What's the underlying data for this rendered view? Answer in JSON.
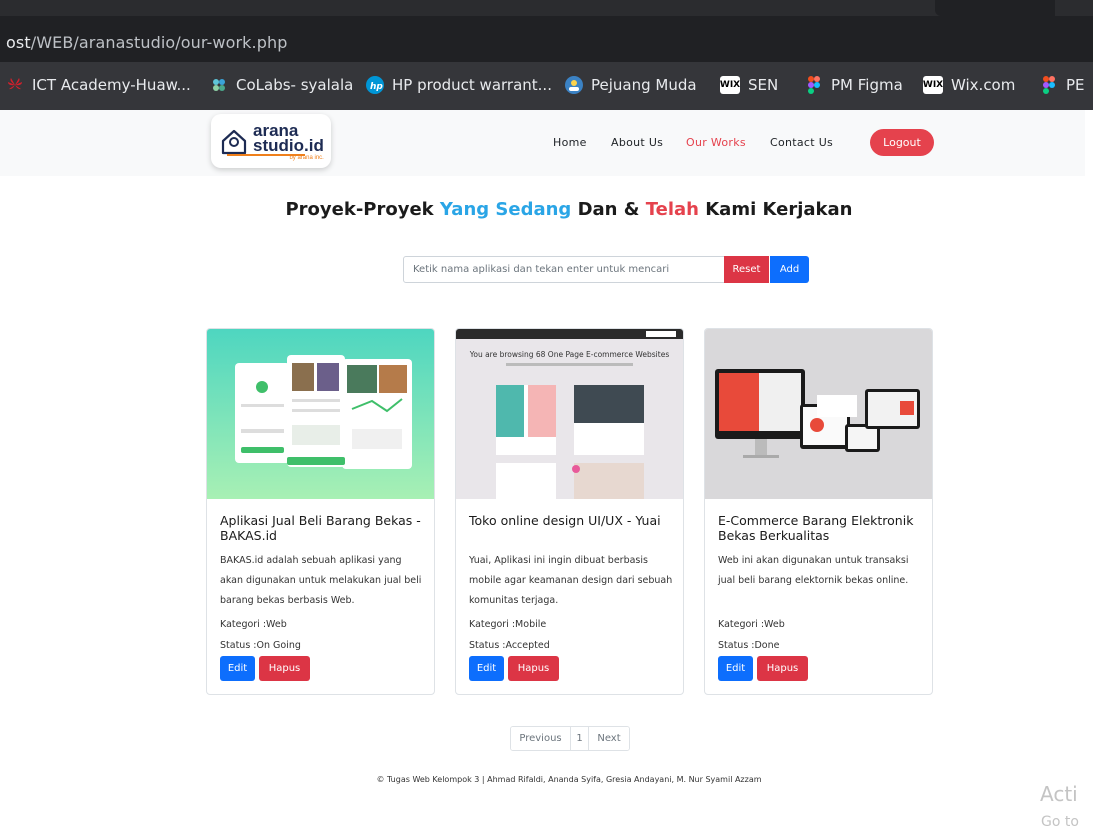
{
  "browser": {
    "url_host": "ost",
    "url_path": "/WEB/aranastudio/our-work.php",
    "bookmarks": [
      {
        "label": "ICT Academy-Huaw...",
        "icon": "huawei-icon",
        "color": "#d3202c"
      },
      {
        "label": "CoLabs- syalala",
        "icon": "colabs-icon",
        "color": "#3aa3d8"
      },
      {
        "label": "HP product warrant...",
        "icon": "hp-icon",
        "color": "#0096d6"
      },
      {
        "label": "Pejuang Muda",
        "icon": "pejuang-muda-icon",
        "color": "#3b82c4"
      },
      {
        "label": "SEN",
        "icon": "wix-icon",
        "color": "#ffffff"
      },
      {
        "label": "PM Figma",
        "icon": "figma-icon",
        "color": "#f24e1e"
      },
      {
        "label": "Wix.com",
        "icon": "wix-icon",
        "color": "#ffffff"
      },
      {
        "label": "PE",
        "icon": "figma-icon",
        "color": "#f24e1e"
      }
    ]
  },
  "logo": {
    "name": "arana",
    "name2": "studio.id",
    "tagline": "by arana inc."
  },
  "nav": {
    "home": "Home",
    "about": "About Us",
    "works": "Our Works",
    "contact": "Contact Us",
    "logout": "Logout"
  },
  "heading": {
    "part1": "Proyek-Proyek ",
    "part2": "Yang Sedang",
    "part3": " Dan & ",
    "part4": "Telah",
    "part5": " Kami Kerjakan"
  },
  "search": {
    "placeholder": "Ketik nama aplikasi dan tekan enter untuk mencari",
    "reset": "Reset",
    "add": "Add"
  },
  "cards": [
    {
      "title": "Aplikasi Jual Beli Barang Bekas - BAKAS.id",
      "desc": "BAKAS.id adalah sebuah aplikasi yang akan digunakan untuk melakukan jual beli barang bekas berbasis Web.",
      "kategori": "Kategori :Web",
      "status": "Status :On Going",
      "edit": "Edit",
      "hapus": "Hapus"
    },
    {
      "title": "Toko online design UI/UX - Yuai",
      "desc": "Yuai, Aplikasi ini ingin dibuat berbasis mobile agar keamanan design dari sebuah komunitas terjaga.",
      "kategori": "Kategori :Mobile",
      "status": "Status :Accepted",
      "edit": "Edit",
      "hapus": "Hapus",
      "image_text": "You are browsing 68 One Page E-commerce Websites"
    },
    {
      "title": "E-Commerce Barang Elektronik Bekas Berkualitas",
      "desc": "Web ini akan digunakan untuk transaksi jual beli barang elektornik bekas online.",
      "kategori": "Kategori :Web",
      "status": "Status :Done",
      "edit": "Edit",
      "hapus": "Hapus"
    }
  ],
  "pagination": {
    "previous": "Previous",
    "page": "1",
    "next": "Next"
  },
  "footer": "© Tugas Web Kelompok 3 | Ahmad Rifaldi, Ananda Syifa, Gresia Andayani, M. Nur Syamil Azzam",
  "watermark": {
    "line1": "Acti",
    "line2": "Go to"
  },
  "colors": {
    "accent_red": "#e5424d",
    "accent_blue": "#2aa5e6",
    "button_blue": "#0d6efd",
    "button_red": "#dc3545"
  }
}
